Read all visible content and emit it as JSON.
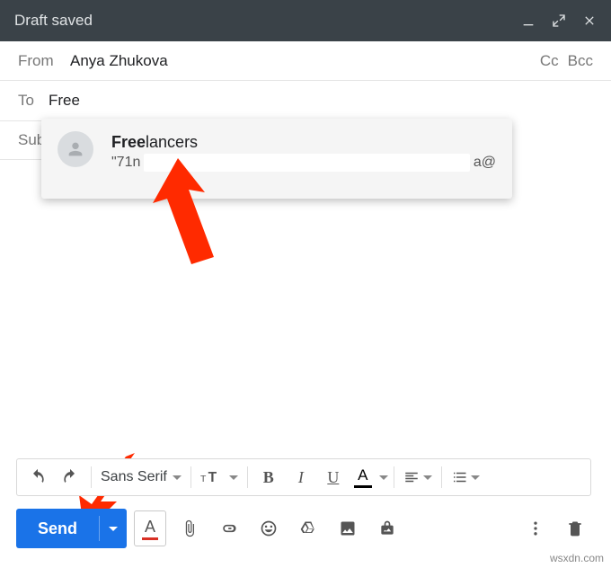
{
  "titlebar": {
    "title": "Draft saved"
  },
  "from": {
    "label": "From",
    "value": "Anya Zhukova"
  },
  "cc": {
    "label": "Cc"
  },
  "bcc": {
    "label": "Bcc"
  },
  "to": {
    "label": "To",
    "value": "Free"
  },
  "subject": {
    "label": "Sub"
  },
  "suggestion": {
    "name_prefix_bold": "Free",
    "name_rest": "lancers",
    "sub_prefix": "\"71n",
    "sub_suffix": "a@"
  },
  "toolbar": {
    "font": "Sans Serif",
    "bold": "B",
    "italic": "I",
    "underline": "U",
    "textA": "A"
  },
  "bottom": {
    "send": "Send",
    "textA": "A"
  },
  "attribution": "wsxdn.com"
}
